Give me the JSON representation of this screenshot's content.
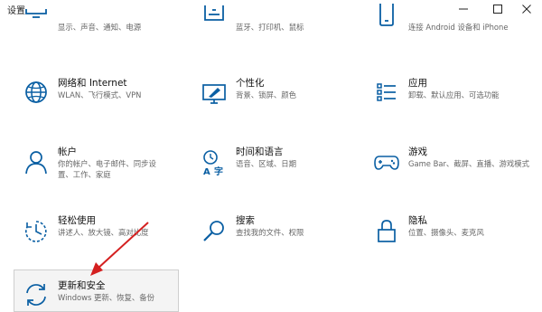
{
  "window": {
    "title": "设置",
    "minimize_icon": "minimize-icon",
    "maximize_icon": "maximize-icon",
    "close_icon": "close-icon"
  },
  "accent_color": "#0a5fa3",
  "partial_row": [
    {
      "icon": "monitor-icon",
      "desc": "显示、声音、通知、电源"
    },
    {
      "icon": "keyboard-icon",
      "desc": "蓝牙、打印机、鼠标"
    },
    {
      "icon": "phone-icon",
      "desc": "连接 Android 设备和 iPhone"
    }
  ],
  "tiles": [
    {
      "name": "网络和 Internet",
      "desc": "WLAN、飞行模式、VPN",
      "icon": "globe-icon"
    },
    {
      "name": "个性化",
      "desc": "背景、锁屏、颜色",
      "icon": "paintbrush-monitor-icon"
    },
    {
      "name": "应用",
      "desc": "卸载、默认应用、可选功能",
      "icon": "apps-list-icon"
    },
    {
      "name": "帐户",
      "desc_lines": [
        "你的帐户、电子邮件、同步设",
        "置、工作、家庭"
      ],
      "icon": "person-icon"
    },
    {
      "name": "时间和语言",
      "desc": "语音、区域、日期",
      "icon": "time-language-icon"
    },
    {
      "name": "游戏",
      "desc": "Game Bar、截屏、直播、游戏模式",
      "icon": "gamepad-icon"
    },
    {
      "name": "轻松使用",
      "desc": "讲述人、放大镜、高对比度",
      "icon": "ease-of-access-icon"
    },
    {
      "name": "搜索",
      "desc": "查找我的文件、权限",
      "icon": "search-icon"
    },
    {
      "name": "隐私",
      "desc": "位置、摄像头、麦克风",
      "icon": "lock-icon"
    },
    {
      "name": "更新和安全",
      "desc": "Windows 更新、恢复、备份",
      "icon": "sync-arrows-icon"
    }
  ]
}
